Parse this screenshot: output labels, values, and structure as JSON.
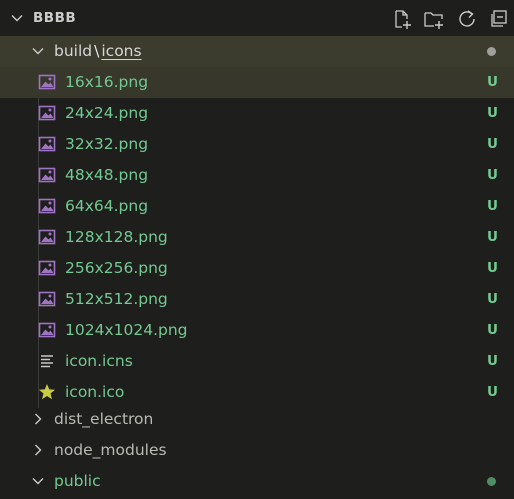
{
  "explorer": {
    "title": "BBBB",
    "toolbar": {
      "new_file_icon": "new-file-icon",
      "new_folder_icon": "new-folder-icon",
      "refresh_icon": "refresh-icon",
      "collapse_icon": "collapse-all-icon"
    },
    "open_folder": {
      "part1": "build",
      "separator": "\\",
      "part2": "icons",
      "status_dot_color": "#a0a09a"
    },
    "files": [
      {
        "name": "16x16.png",
        "badge": "U",
        "icon": "image-file-icon"
      },
      {
        "name": "24x24.png",
        "badge": "U",
        "icon": "image-file-icon"
      },
      {
        "name": "32x32.png",
        "badge": "U",
        "icon": "image-file-icon"
      },
      {
        "name": "48x48.png",
        "badge": "U",
        "icon": "image-file-icon"
      },
      {
        "name": "64x64.png",
        "badge": "U",
        "icon": "image-file-icon"
      },
      {
        "name": "128x128.png",
        "badge": "U",
        "icon": "image-file-icon"
      },
      {
        "name": "256x256.png",
        "badge": "U",
        "icon": "image-file-icon"
      },
      {
        "name": "512x512.png",
        "badge": "U",
        "icon": "image-file-icon"
      },
      {
        "name": "1024x1024.png",
        "badge": "U",
        "icon": "image-file-icon"
      },
      {
        "name": "icon.icns",
        "badge": "U",
        "icon": "text-file-icon"
      },
      {
        "name": "icon.ico",
        "badge": "U",
        "icon": "star-file-icon"
      }
    ],
    "collapsed_folders": [
      {
        "name": "dist_electron"
      },
      {
        "name": "node_modules"
      }
    ],
    "public_folder": {
      "name": "public",
      "status_dot_color": "#4d8f63"
    },
    "colors": {
      "untracked_green": "#73c991",
      "image_icon_purple": "#a074c4",
      "star_yellow": "#cbcb41"
    }
  }
}
